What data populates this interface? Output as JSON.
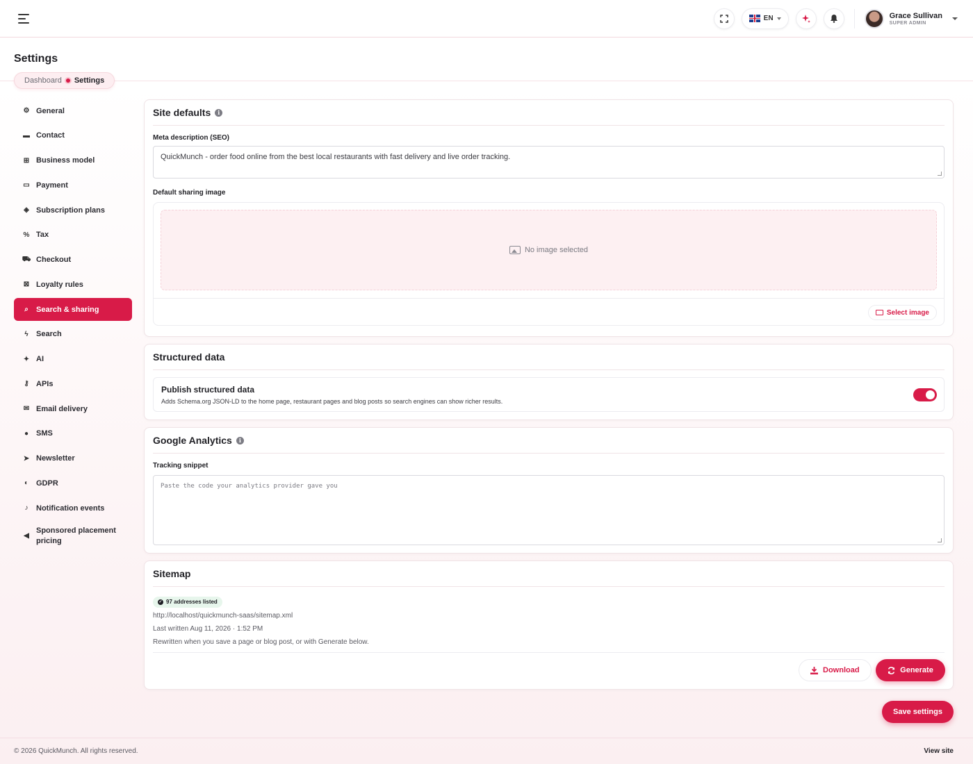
{
  "topbar": {
    "language": "EN",
    "user": {
      "name": "Grace Sullivan",
      "role": "SUPER ADMIN"
    }
  },
  "page": {
    "title": "Settings"
  },
  "breadcrumb": {
    "home": "Dashboard",
    "current": "Settings"
  },
  "sidebar": {
    "items": [
      {
        "label": "General",
        "icon": "gear-icon",
        "glyph": "⚙"
      },
      {
        "label": "Contact",
        "icon": "id-card-icon",
        "glyph": "▬"
      },
      {
        "label": "Business model",
        "icon": "sitemap-icon",
        "glyph": "⊞"
      },
      {
        "label": "Payment",
        "icon": "credit-card-icon",
        "glyph": "▭"
      },
      {
        "label": "Subscription plans",
        "icon": "layers-icon",
        "glyph": "◈"
      },
      {
        "label": "Tax",
        "icon": "percent-icon",
        "glyph": "%"
      },
      {
        "label": "Checkout",
        "icon": "cart-icon",
        "glyph": "⛟"
      },
      {
        "label": "Loyalty rules",
        "icon": "gift-icon",
        "glyph": "⊠"
      },
      {
        "label": "Search & sharing",
        "icon": "search-icon",
        "glyph": "⌕",
        "active": true
      },
      {
        "label": "Search",
        "icon": "bolt-icon",
        "glyph": "ϟ"
      },
      {
        "label": "AI",
        "icon": "sparkles-icon",
        "glyph": "✦"
      },
      {
        "label": "APIs",
        "icon": "key-icon",
        "glyph": "⚷"
      },
      {
        "label": "Email delivery",
        "icon": "envelope-icon",
        "glyph": "✉"
      },
      {
        "label": "SMS",
        "icon": "chat-icon",
        "glyph": "●"
      },
      {
        "label": "Newsletter",
        "icon": "paper-plane-icon",
        "glyph": "➤"
      },
      {
        "label": "GDPR",
        "icon": "shield-icon",
        "glyph": "◐"
      },
      {
        "label": "Notification events",
        "icon": "bell-icon",
        "glyph": "♪"
      },
      {
        "label": "Sponsored placement pricing",
        "icon": "megaphone-icon",
        "glyph": "◀"
      }
    ]
  },
  "site_defaults": {
    "title": "Site defaults",
    "meta_label": "Meta description (SEO)",
    "meta_value": "QuickMunch - order food online from the best local restaurants with fast delivery and live order tracking.",
    "image_label": "Default sharing image",
    "no_image": "No image selected",
    "select_image": "Select image"
  },
  "structured_data": {
    "title": "Structured data",
    "toggle_title": "Publish structured data",
    "toggle_desc": "Adds Schema.org JSON-LD to the home page, restaurant pages and blog posts so search engines can show richer results.",
    "enabled": true
  },
  "google_analytics": {
    "title": "Google Analytics",
    "snippet_label": "Tracking snippet",
    "snippet_placeholder": "Paste the code your analytics provider gave you"
  },
  "sitemap": {
    "title": "Sitemap",
    "badge": "97 addresses listed",
    "url": "http://localhost/quickmunch-saas/sitemap.xml",
    "last_written": "Last written Aug 11, 2026 · 1:52 PM",
    "note": "Rewritten when you save a page or blog post, or with Generate below.",
    "download": "Download",
    "generate": "Generate"
  },
  "actions": {
    "save": "Save settings"
  },
  "footer": {
    "copyright": "© 2026 QuickMunch. All rights reserved.",
    "view_site": "View site"
  },
  "colors": {
    "accent": "#d81b48"
  }
}
